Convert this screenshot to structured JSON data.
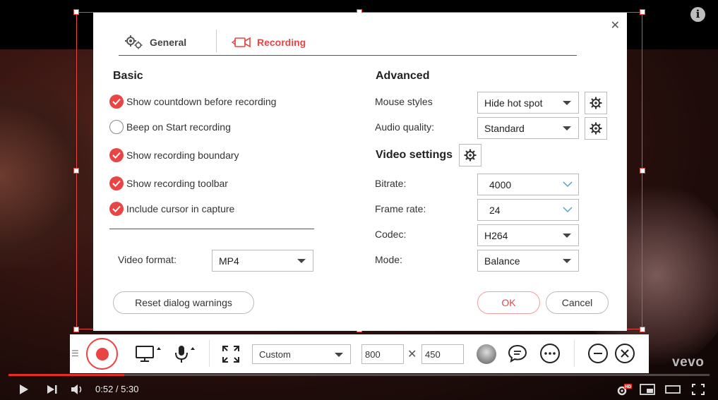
{
  "colors": {
    "accent": "#e84545",
    "progress": "#e52d27"
  },
  "dialog": {
    "close_icon": "close-icon",
    "tabs": [
      {
        "label": "General",
        "icon": "gears-icon",
        "active": false
      },
      {
        "label": "Recording",
        "icon": "video-camera-icon",
        "active": true
      }
    ],
    "basic": {
      "title": "Basic",
      "options": [
        {
          "label": "Show countdown before recording",
          "checked": true
        },
        {
          "label": "Beep on Start recording",
          "checked": false
        },
        {
          "label": "Show recording boundary",
          "checked": true
        },
        {
          "label": "Show recording toolbar",
          "checked": true
        },
        {
          "label": "Include cursor in capture",
          "checked": true
        }
      ],
      "video_format": {
        "label": "Video format:",
        "value": "MP4"
      }
    },
    "advanced": {
      "title": "Advanced",
      "mouse_styles": {
        "label": "Mouse styles",
        "value": "Hide hot spot"
      },
      "audio_quality": {
        "label": "Audio quality:",
        "value": "Standard"
      }
    },
    "video_settings": {
      "title": "Video settings",
      "bitrate": {
        "label": "Bitrate:",
        "value": "4000"
      },
      "frame_rate": {
        "label": "Frame rate:",
        "value": "24"
      },
      "codec": {
        "label": "Codec:",
        "value": "H264"
      },
      "mode": {
        "label": "Mode:",
        "value": "Balance"
      }
    },
    "buttons": {
      "reset": "Reset dialog warnings",
      "ok": "OK",
      "cancel": "Cancel"
    }
  },
  "toolbar": {
    "region_select": "Custom",
    "width": "800",
    "height": "450",
    "times_symbol": "✕"
  },
  "player": {
    "time": "0:52 / 5:30",
    "progress": 0.165,
    "brand": "vevo",
    "hd_badge": "HD"
  }
}
